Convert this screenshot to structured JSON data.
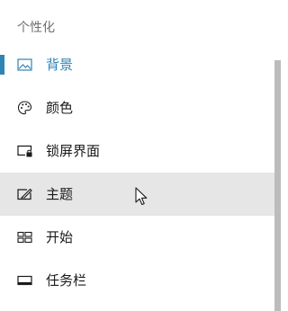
{
  "section": {
    "title": "个性化"
  },
  "nav": {
    "items": [
      {
        "label": "背景",
        "icon": "image-icon"
      },
      {
        "label": "颜色",
        "icon": "palette-icon"
      },
      {
        "label": "锁屏界面",
        "icon": "lock-screen-icon"
      },
      {
        "label": "主题",
        "icon": "theme-icon"
      },
      {
        "label": "开始",
        "icon": "start-icon"
      },
      {
        "label": "任务栏",
        "icon": "taskbar-icon"
      }
    ],
    "selected_label": "背景",
    "hovered_label": "主题"
  },
  "colors": {
    "accent": "#2f84b6",
    "hover_background": "#e6e6e6",
    "text": "#1a1a1a",
    "section_title": "#6f6f6f",
    "scrollbar": "#bcbcbc"
  }
}
